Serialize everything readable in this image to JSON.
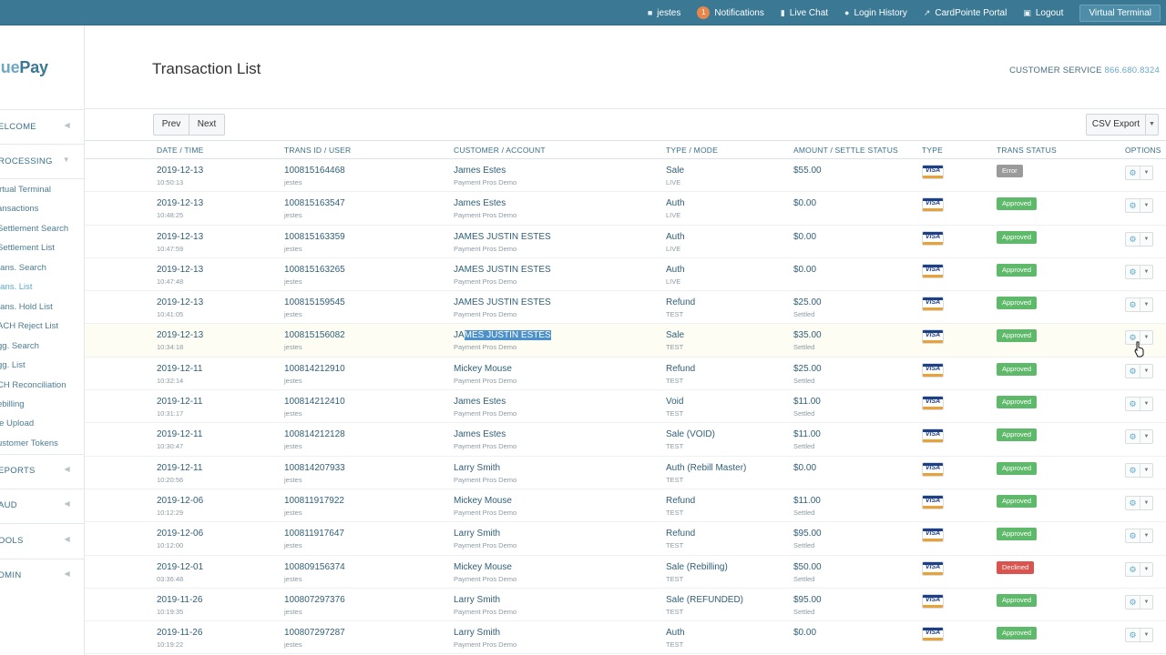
{
  "topbar": {
    "user": "jestes",
    "notifications_count": "1",
    "notifications": "Notifications",
    "live_chat": "Live Chat",
    "login_history": "Login History",
    "portal": "CardPointe Portal",
    "logout": "Logout",
    "virtual_terminal": "Virtual Terminal"
  },
  "logo": {
    "part1": "lue",
    "part2": "Pay"
  },
  "sidebar": {
    "welcome": "ELCOME",
    "processing": "ROCESSING",
    "items": [
      "irtual Terminal",
      "ansactions",
      "Settlement Search",
      "Settlement List",
      "rans. Search",
      "rans. List",
      "rans. Hold List",
      "ACH Reject List",
      "gg. Search",
      "gg. List",
      "CH Reconciliation",
      "ebilling",
      "le Upload",
      "ustomer Tokens"
    ],
    "reports": "EPORTS",
    "fraud": "AUD",
    "tools": "OOLS",
    "admin": "DMIN"
  },
  "page": {
    "title": "Transaction List",
    "customer_service_label": "CUSTOMER SERVICE",
    "customer_service_phone": "866.680.8324"
  },
  "toolbar": {
    "prev": "Prev",
    "next": "Next",
    "csv": "CSV Export"
  },
  "columns": {
    "date": "DATE / TIME",
    "trans": "TRANS ID / USER",
    "customer": "CUSTOMER / ACCOUNT",
    "type_mode": "TYPE / MODE",
    "amount": "AMOUNT / SETTLE STATUS",
    "type": "TYPE",
    "status": "TRANS STATUS",
    "options": "OPTIONS"
  },
  "rows": [
    {
      "date": "2019-12-13",
      "time": "10:50:13",
      "id": "100815164468",
      "user": "jestes",
      "customer": "James Estes",
      "account": "Payment Pros Demo",
      "type": "Sale",
      "mode": "LIVE",
      "amount": "$55.00",
      "settle": "",
      "status": "Error"
    },
    {
      "date": "2019-12-13",
      "time": "10:48:25",
      "id": "100815163547",
      "user": "jestes",
      "customer": "James Estes",
      "account": "Payment Pros Demo",
      "type": "Auth",
      "mode": "LIVE",
      "amount": "$0.00",
      "settle": "",
      "status": "Approved"
    },
    {
      "date": "2019-12-13",
      "time": "10:47:59",
      "id": "100815163359",
      "user": "jestes",
      "customer": "JAMES JUSTIN ESTES",
      "account": "Payment Pros Demo",
      "type": "Auth",
      "mode": "LIVE",
      "amount": "$0.00",
      "settle": "",
      "status": "Approved"
    },
    {
      "date": "2019-12-13",
      "time": "10:47:48",
      "id": "100815163265",
      "user": "jestes",
      "customer": "JAMES JUSTIN ESTES",
      "account": "Payment Pros Demo",
      "type": "Auth",
      "mode": "LIVE",
      "amount": "$0.00",
      "settle": "",
      "status": "Approved"
    },
    {
      "date": "2019-12-13",
      "time": "10:41:05",
      "id": "100815159545",
      "user": "jestes",
      "customer": "JAMES JUSTIN ESTES",
      "account": "Payment Pros Demo",
      "type": "Refund",
      "mode": "TEST",
      "amount": "$25.00",
      "settle": "Settled",
      "status": "Approved"
    },
    {
      "date": "2019-12-13",
      "time": "10:34:18",
      "id": "100815156082",
      "user": "jestes",
      "customer": "JAMES JUSTIN ESTES",
      "account": "Payment Pros Demo",
      "type": "Sale",
      "mode": "TEST",
      "amount": "$35.00",
      "settle": "Settled",
      "status": "Approved"
    },
    {
      "date": "2019-12-11",
      "time": "10:32:14",
      "id": "100814212910",
      "user": "jestes",
      "customer": "Mickey Mouse",
      "account": "Payment Pros Demo",
      "type": "Refund",
      "mode": "TEST",
      "amount": "$25.00",
      "settle": "Settled",
      "status": "Approved"
    },
    {
      "date": "2019-12-11",
      "time": "10:31:17",
      "id": "100814212410",
      "user": "jestes",
      "customer": "James Estes",
      "account": "Payment Pros Demo",
      "type": "Void",
      "mode": "TEST",
      "amount": "$11.00",
      "settle": "Settled",
      "status": "Approved"
    },
    {
      "date": "2019-12-11",
      "time": "10:30:47",
      "id": "100814212128",
      "user": "jestes",
      "customer": "James Estes",
      "account": "Payment Pros Demo",
      "type": "Sale (VOID)",
      "mode": "TEST",
      "amount": "$11.00",
      "settle": "Settled",
      "status": "Approved"
    },
    {
      "date": "2019-12-11",
      "time": "10:20:56",
      "id": "100814207933",
      "user": "jestes",
      "customer": "Larry Smith",
      "account": "Payment Pros Demo",
      "type": "Auth (Rebill Master)",
      "mode": "TEST",
      "amount": "$0.00",
      "settle": "",
      "status": "Approved"
    },
    {
      "date": "2019-12-06",
      "time": "10:12:29",
      "id": "100811917922",
      "user": "jestes",
      "customer": "Mickey Mouse",
      "account": "Payment Pros Demo",
      "type": "Refund",
      "mode": "TEST",
      "amount": "$11.00",
      "settle": "Settled",
      "status": "Approved"
    },
    {
      "date": "2019-12-06",
      "time": "10:12:00",
      "id": "100811917647",
      "user": "jestes",
      "customer": "Larry Smith",
      "account": "Payment Pros Demo",
      "type": "Refund",
      "mode": "TEST",
      "amount": "$95.00",
      "settle": "Settled",
      "status": "Approved"
    },
    {
      "date": "2019-12-01",
      "time": "03:36:48",
      "id": "100809156374",
      "user": "jestes",
      "customer": "Mickey Mouse",
      "account": "Payment Pros Demo",
      "type": "Sale (Rebilling)",
      "mode": "TEST",
      "amount": "$50.00",
      "settle": "Settled",
      "status": "Declined"
    },
    {
      "date": "2019-11-26",
      "time": "10:19:35",
      "id": "100807297376",
      "user": "jestes",
      "customer": "Larry Smith",
      "account": "Payment Pros Demo",
      "type": "Sale (REFUNDED)",
      "mode": "TEST",
      "amount": "$95.00",
      "settle": "Settled",
      "status": "Approved"
    },
    {
      "date": "2019-11-26",
      "time": "10:19:22",
      "id": "100807297287",
      "user": "jestes",
      "customer": "Larry Smith",
      "account": "Payment Pros Demo",
      "type": "Auth",
      "mode": "TEST",
      "amount": "$0.00",
      "settle": "",
      "status": "Approved"
    }
  ],
  "card_brand": "VISA",
  "highlighted_row": 5,
  "selected_text": {
    "before": "JA",
    "selected": "MES JUSTIN ESTES"
  },
  "colors": {
    "topbar": "#3a7893",
    "link": "#2f5f78",
    "approved": "#5fb96a",
    "error": "#9a9a9a",
    "declined": "#d9534f",
    "accent": "#5ba8cf"
  }
}
